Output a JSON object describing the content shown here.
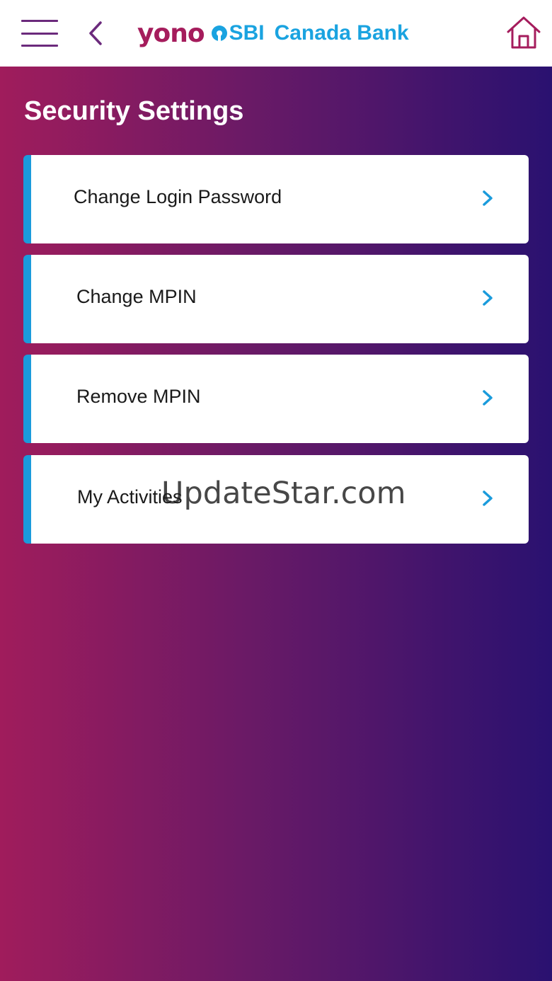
{
  "header": {
    "logo": {
      "yono": "yono",
      "sbi": "SBI",
      "bank": "Canada Bank"
    },
    "icons": {
      "menu": "hamburger-menu-icon",
      "back": "chevron-left-icon",
      "home": "home-icon"
    }
  },
  "page": {
    "title": "Security Settings"
  },
  "menu_items": [
    {
      "label": "Change Login Password"
    },
    {
      "label": "Change MPIN"
    },
    {
      "label": "Remove MPIN"
    },
    {
      "label": "My Activities"
    }
  ],
  "watermark": "UpdateStar.com",
  "colors": {
    "accent": "#1a9bdc",
    "brand_pink": "#a51c5c",
    "gradient_left": "#a01c5c",
    "gradient_right": "#2a1170"
  }
}
